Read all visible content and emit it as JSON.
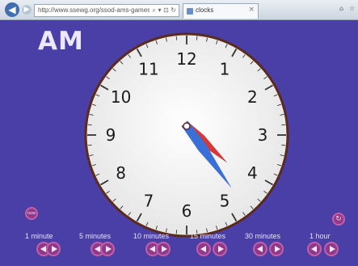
{
  "browser": {
    "address": "http://www.ssewg.org/ssod-ams-games/ClockGame/easier",
    "address_icons": "⌕ ▾ ⊡ ↻",
    "tab_title": "clocks",
    "tab_close": "×"
  },
  "app": {
    "period": "AM",
    "clock_numbers": [
      "12",
      "1",
      "2",
      "3",
      "4",
      "5",
      "6",
      "7",
      "8",
      "9",
      "10",
      "11"
    ],
    "time": {
      "hour": 4,
      "minute": 24
    },
    "colors": {
      "hour_hand": "#d23a3a",
      "minute_hand": "#3a6fd8",
      "background": "#4a3fa6",
      "face": "#f7f7f7",
      "rim": "#5a2a1a"
    },
    "left_button_label": "now",
    "steps": [
      {
        "label": "1 minute"
      },
      {
        "label": "5 minutes"
      },
      {
        "label": "10 minutes"
      },
      {
        "label": "15 minutes"
      },
      {
        "label": "30 minutes"
      },
      {
        "label": "1 hour"
      }
    ]
  }
}
